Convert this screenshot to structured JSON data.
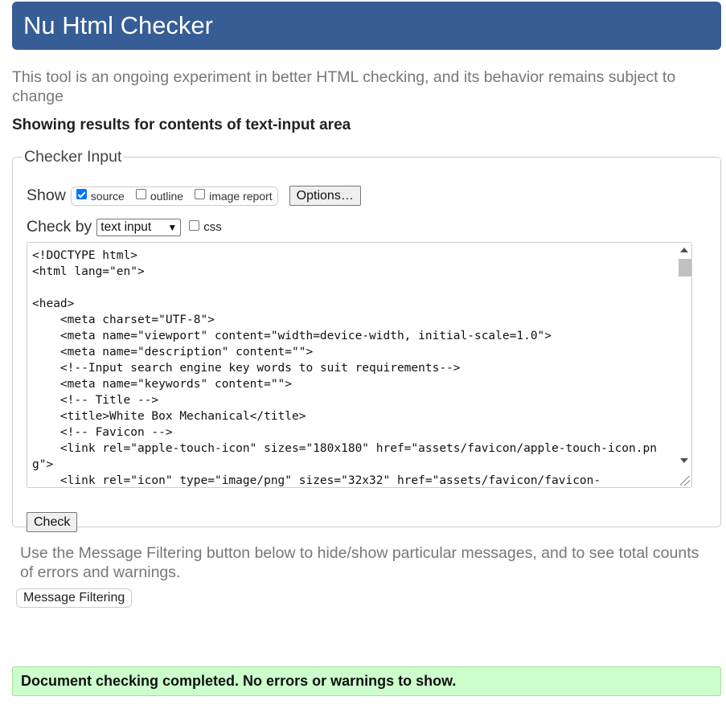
{
  "header": {
    "title": "Nu Html Checker"
  },
  "intro": "This tool is an ongoing experiment in better HTML checking, and its behavior remains subject to change",
  "results_heading": "Showing results for contents of text-input area",
  "checker": {
    "legend": "Checker Input",
    "show_label": "Show",
    "show_options": [
      {
        "label": "source",
        "checked": true
      },
      {
        "label": "outline",
        "checked": false
      },
      {
        "label": "image report",
        "checked": false
      }
    ],
    "options_button": "Options…",
    "check_by_label": "Check by",
    "check_by_selected": "text input",
    "css_label": "css",
    "css_checked": false,
    "source_text": "<!DOCTYPE html>\n<html lang=\"en\">\n\n<head>\n    <meta charset=\"UTF-8\">\n    <meta name=\"viewport\" content=\"width=device-width, initial-scale=1.0\">\n    <meta name=\"description\" content=\"\">\n    <!--Input search engine key words to suit requirements-->\n    <meta name=\"keywords\" content=\"\">\n    <!-- Title -->\n    <title>White Box Mechanical</title>\n    <!-- Favicon -->\n    <link rel=\"apple-touch-icon\" sizes=\"180x180\" href=\"assets/favicon/apple-touch-icon.png\">\n    <link rel=\"icon\" type=\"image/png\" sizes=\"32x32\" href=\"assets/favicon/favicon-",
    "check_button": "Check"
  },
  "filter_text": "Use the Message Filtering button below to hide/show particular messages, and to see total counts of errors and warnings.",
  "filter_button": "Message Filtering",
  "success_message": "Document checking completed. No errors or warnings to show.",
  "colors": {
    "header_bg": "#365d95",
    "success_bg": "#ccffcc",
    "checkbox_accent": "#0075ff"
  }
}
